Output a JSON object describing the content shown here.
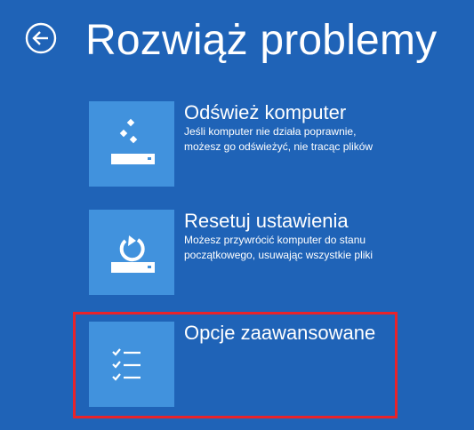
{
  "header": {
    "back_icon": "back-arrow-circle-icon",
    "title": "Rozwiąż problemy"
  },
  "options": [
    {
      "id": "refresh",
      "icon": "refresh-pc-icon",
      "title": "Odśwież komputer",
      "description_lines": [
        "Jeśli komputer nie działa poprawnie,",
        "możesz go odświeżyć, nie tracąc plików"
      ]
    },
    {
      "id": "reset",
      "icon": "reset-pc-icon",
      "title": "Resetuj ustawienia",
      "description_lines": [
        "Możesz przywrócić komputer do stanu",
        "początkowego, usuwając wszystkie pliki"
      ]
    },
    {
      "id": "advanced",
      "icon": "checklist-icon",
      "title": "Opcje zaawansowane",
      "description_lines": []
    }
  ],
  "colors": {
    "background": "#1f63b7",
    "tile": "#4192dd",
    "text": "#ffffff",
    "highlight": "#e8232a"
  }
}
